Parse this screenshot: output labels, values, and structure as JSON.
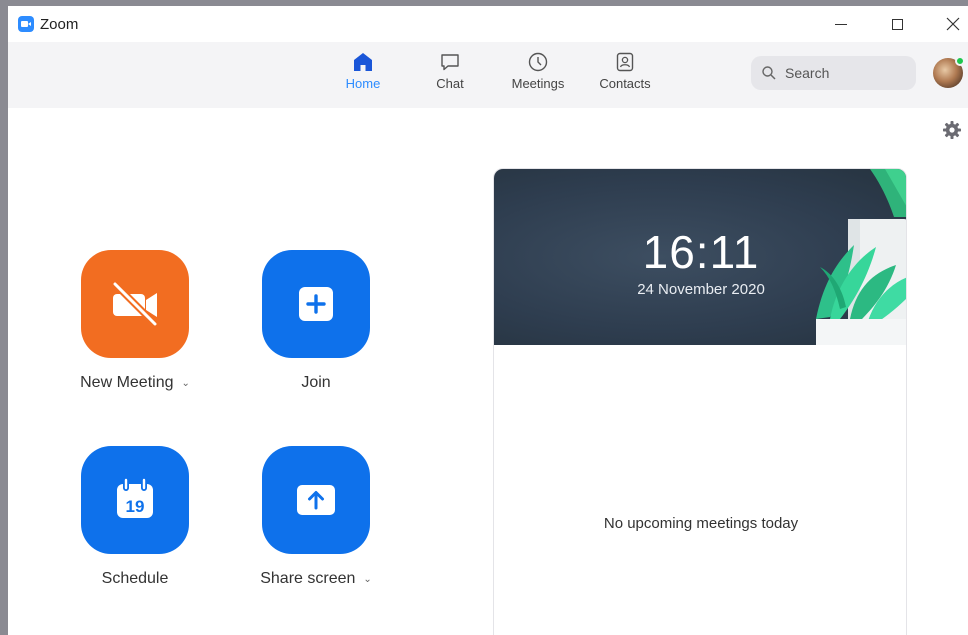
{
  "window": {
    "title": "Zoom"
  },
  "nav": {
    "tabs": [
      {
        "label": "Home",
        "icon": "home-icon",
        "active": true
      },
      {
        "label": "Chat",
        "icon": "chat-icon",
        "active": false
      },
      {
        "label": "Meetings",
        "icon": "clock-icon",
        "active": false
      },
      {
        "label": "Contacts",
        "icon": "contacts-icon",
        "active": false
      }
    ],
    "search_placeholder": "Search"
  },
  "actions": {
    "new_meeting": {
      "label": "New Meeting",
      "icon": "video-off-icon",
      "color": "#f26d21"
    },
    "join": {
      "label": "Join",
      "icon": "plus-icon",
      "color": "#0e71eb"
    },
    "schedule": {
      "label": "Schedule",
      "icon": "calendar-icon",
      "day": "19",
      "color": "#0e71eb"
    },
    "share_screen": {
      "label": "Share screen",
      "icon": "share-up-arrow-icon",
      "color": "#0e71eb"
    }
  },
  "calendar": {
    "time": "16:11",
    "date": "24 November 2020",
    "empty_message": "No upcoming meetings today"
  },
  "colors": {
    "accent": "#2d8cff",
    "presence": "#1ec74e"
  }
}
